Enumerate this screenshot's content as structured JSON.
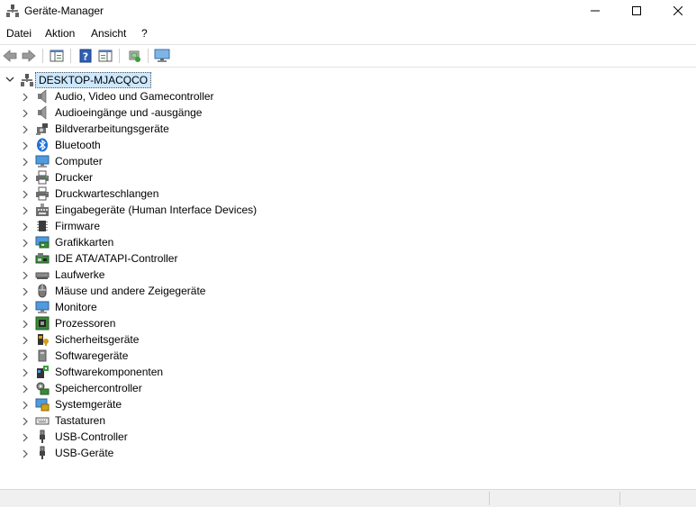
{
  "window": {
    "title": "Geräte-Manager"
  },
  "menu": [
    {
      "label": "Datei"
    },
    {
      "label": "Aktion"
    },
    {
      "label": "Ansicht"
    },
    {
      "label": "?"
    }
  ],
  "toolbar": [
    {
      "icon": "back-arrow-icon"
    },
    {
      "icon": "forward-arrow-icon"
    },
    {
      "icon": "show-hide-console-tree-icon"
    },
    {
      "icon": "help-icon"
    },
    {
      "icon": "properties-panel-icon"
    },
    {
      "icon": "scan-hardware-icon"
    },
    {
      "icon": "monitor-devices-icon"
    }
  ],
  "tree": {
    "root": "DESKTOP-MJACQCO",
    "items": [
      {
        "label": "Audio, Video und Gamecontroller",
        "icon": "speaker-icon"
      },
      {
        "label": "Audioeingänge und -ausgänge",
        "icon": "speaker-icon"
      },
      {
        "label": "Bildverarbeitungsgeräte",
        "icon": "camera-icon"
      },
      {
        "label": "Bluetooth",
        "icon": "bluetooth-icon"
      },
      {
        "label": "Computer",
        "icon": "computer-icon"
      },
      {
        "label": "Drucker",
        "icon": "printer-icon"
      },
      {
        "label": "Druckwarteschlangen",
        "icon": "printer-icon"
      },
      {
        "label": "Eingabegeräte (Human Interface Devices)",
        "icon": "hid-icon"
      },
      {
        "label": "Firmware",
        "icon": "chip-icon"
      },
      {
        "label": "Grafikkarten",
        "icon": "display-adapter-icon"
      },
      {
        "label": "IDE ATA/ATAPI-Controller",
        "icon": "ide-controller-icon"
      },
      {
        "label": "Laufwerke",
        "icon": "disk-drive-icon"
      },
      {
        "label": "Mäuse und andere Zeigegeräte",
        "icon": "mouse-icon"
      },
      {
        "label": "Monitore",
        "icon": "monitor-icon"
      },
      {
        "label": "Prozessoren",
        "icon": "processor-icon"
      },
      {
        "label": "Sicherheitsgeräte",
        "icon": "security-device-icon"
      },
      {
        "label": "Softwaregeräte",
        "icon": "software-device-icon"
      },
      {
        "label": "Softwarekomponenten",
        "icon": "software-component-icon"
      },
      {
        "label": "Speichercontroller",
        "icon": "storage-controller-icon"
      },
      {
        "label": "Systemgeräte",
        "icon": "system-device-icon"
      },
      {
        "label": "Tastaturen",
        "icon": "keyboard-icon"
      },
      {
        "label": "USB-Controller",
        "icon": "usb-icon"
      },
      {
        "label": "USB-Geräte",
        "icon": "usb-icon"
      }
    ]
  },
  "colors": {
    "selection": "#cce8ff",
    "accent": "#1a73d9",
    "statusbar": "#f0f0f0"
  }
}
